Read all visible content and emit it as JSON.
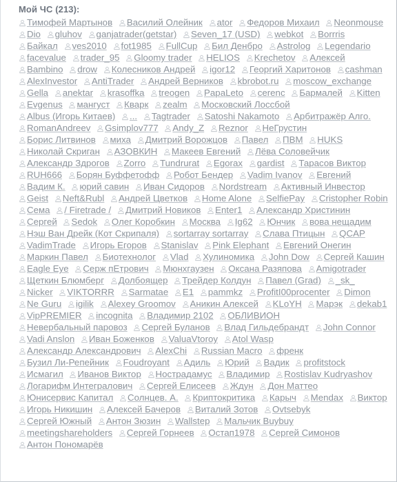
{
  "block": {
    "title": "Мой ЧС (213):",
    "icon": "user-icon",
    "count": 213,
    "colors": {
      "text": "#8e959d",
      "title": "#6f7680",
      "underline": "#b6bcc3",
      "background": "#ffffff",
      "border": "#c3c8ce"
    }
  },
  "users": [
    "Тимофей Мартынов",
    "Василий Олейник",
    "ator",
    "Федоров Михаил",
    "Neonmouse",
    "Dio",
    "gluhov",
    "ganjatrader(getstar)",
    "Seven_17 (USD)",
    "webkot",
    "Borrris",
    "Байкал",
    "ves2010",
    "fot1985",
    "FullCup",
    "Бил Денбро",
    "Astrolog",
    "Legendario",
    "facevalue",
    "trader_95",
    "Gloomy trader",
    "HELIOS",
    "Krechetov",
    "Алексей",
    "Bambino",
    "drow",
    "Колесников Андрей",
    "igor12",
    "Георгий Харитонов",
    "cashman",
    "AlexInvestor",
    "AntiTrader",
    "Андрей Верников",
    "kbrobot.ru",
    "moscow_exchange",
    "Gella",
    "anektar",
    "krasoffka",
    "treogen",
    "PapaLeto",
    "cerenc",
    "Бармалей",
    "Kitten",
    "Evgenus",
    "мангуст",
    "Кварк",
    "zealm",
    "Московский Лоссбой",
    "Albus (Игорь Китаев)",
    "...",
    "Tagtrader",
    "Satoshi Nakamoto",
    "Арбитражёр Алго.",
    "RomanAndreev",
    "Gsimplov777",
    "Andy_Z",
    "Reznor",
    "НеГрустин",
    "Борис Литвинов",
    "миха",
    "Дмитрий Ворожцов",
    "Павел",
    "ПВМ",
    "HUKS",
    "Николай Скриган",
    "АЗОВКИН",
    "Макеев Евгений",
    "Лёва Соловейчик",
    "Александр Здрогов",
    "Zorro",
    "Tundrurat",
    "Egorax",
    "gardist",
    "Тарасов Виктор",
    "RUH666",
    "Борян Буффетофф",
    "Робот Бендер",
    "Vadim Ivanov",
    "Евгений",
    "Вадим К.",
    "юрий савин",
    "Иван Сидоров",
    "Nordstream",
    "Активный Инвестор",
    "Geist",
    "Neft&Rubl",
    "Андрей Цветков",
    "Home Alone",
    "SelfiePay",
    "Cristopher Robin",
    "Сема",
    "/ Firetrade /",
    "Дмитрий Новиков",
    "Enter1",
    "Александр Христинин",
    "Сергей",
    "Sedok",
    "Олег Коробкин",
    "Москва",
    "Ig62",
    "Юнчик",
    "вова нещадим",
    "Нэш Ван Дрейк (Кот Скрипаля)",
    "sortarray sortarray",
    "Слава Птицын",
    "QCAP",
    "VadimTrade",
    "Игорь Егоров",
    "Stanislav",
    "Pink Elephant",
    "Евгений Онегин",
    "Маркин Павел",
    "Биотехнолог",
    "Vlad",
    "Хулиномика",
    "John Dow",
    "Сергей Кашин",
    "Eagle Eye",
    "Серж пЕтрович",
    "Мюнхгаузен",
    "Оксана Разяпова",
    "Amigotrader",
    "Щеткин Блюмберг",
    "Долбоящер",
    "Трейдер Колдун",
    "Павел (Grad)",
    "_sk_",
    "Nicker",
    "VIKTORRR",
    "Sarmatae",
    "E1",
    "pammkz",
    "ProfitI00procenter",
    "Dimon",
    "Ne Guru",
    "igilik",
    "Alexey Groomov",
    "Аникин Алексей",
    "KLoYH",
    "Марэк",
    "dekab1",
    "VipPREMIER",
    "incognita",
    "Владимир 2102",
    "ОБЛИВИОН",
    "Невербальный паровоз",
    "Сергей Буланов",
    "Влад Гильдебрандт",
    "John Connor",
    "Vadi Anslon",
    "Иван Боженков",
    "ValuaVtoroy",
    "Atol Wasp",
    "Александр Александрович",
    "AlexChi",
    "Russian Macro",
    "френк",
    "Бузил Ли-Репейник",
    "Foudroyant",
    "Адиль",
    "Юрий",
    "Вадик",
    "profitstock",
    "Исмагил",
    "Иванов Виктор",
    "Нострадамус",
    "Владимир",
    "Rostislav Kudryashov",
    "Логарифм Интегралович",
    "Сергей Елисеев",
    "Ждун",
    "Дон Маттео",
    "Юнисервис Капитал",
    "Солнцев. А.",
    "Криптокритика",
    "Карыч",
    "Mendax",
    "Виктор",
    "Игорь Никишин",
    "Алексей Бачеров",
    "Виталий Зотов",
    "Ovtsebyk",
    "Сергей Южный",
    "Антон Зюзин",
    "Wallstep",
    "Мальчик Buybuy",
    "meetingshareholders",
    "Сергей Горнеев",
    "Остап1978",
    "Сергей Симонов",
    "Антон Пономарёв"
  ]
}
